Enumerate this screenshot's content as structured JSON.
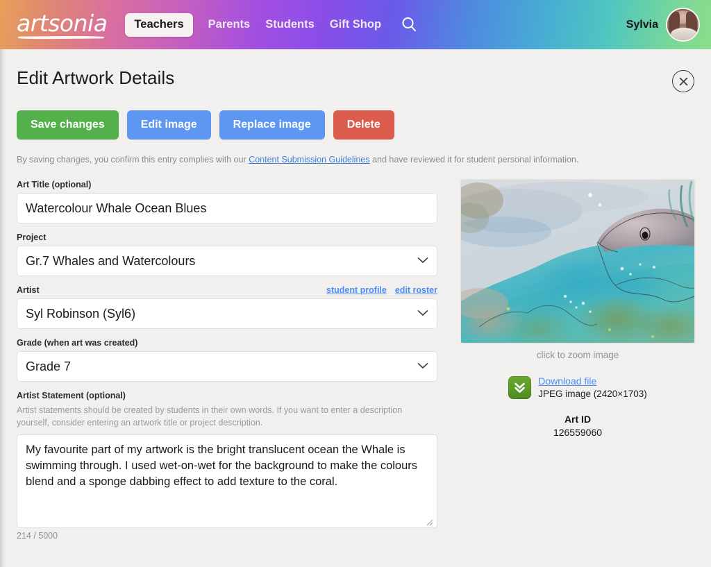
{
  "topnav": {
    "logo_text": "artsonia",
    "active_tab": "Teachers",
    "links": [
      "Parents",
      "Students",
      "Gift Shop"
    ],
    "search_icon": "search-icon",
    "user_name": "Sylvia",
    "gradient_start": "#e8a05a",
    "gradient_end": "#8ddc8a"
  },
  "page": {
    "title": "Edit Artwork Details",
    "close_icon": "close-icon"
  },
  "toolbar": {
    "save_label": "Save changes",
    "edit_image_label": "Edit image",
    "replace_image_label": "Replace image",
    "delete_label": "Delete",
    "save_color": "#53b04b",
    "edit_color": "#5d97f2",
    "replace_color": "#5d97f2",
    "delete_color": "#dc5c4e"
  },
  "disclaimer": {
    "before": "By saving changes, you confirm this entry complies with our ",
    "link": "Content Submission Guidelines",
    "after": " and have reviewed it for student personal information."
  },
  "form": {
    "art_title": {
      "label": "Art Title (optional)",
      "value": "Watercolour Whale Ocean Blues",
      "placeholder": ""
    },
    "project": {
      "label": "Project",
      "value": "Gr.7 Whales and Watercolours"
    },
    "artist": {
      "label": "Artist",
      "value": "Syl Robinson (Syl6)",
      "link_profile": "student profile",
      "link_roster": "edit roster"
    },
    "grade": {
      "label": "Grade (when art was created)",
      "value": "Grade 7"
    },
    "statement": {
      "label": "Artist Statement (optional)",
      "helper": "Artist statements should be created by students in their own words. If you want to enter a description yourself, consider entering an artwork title or project description.",
      "value": "My favourite part of my artwork is the bright translucent ocean the Whale is swimming through. I used wet-on-wet for the background to make the colours blend and a sponge dabbing effect to add texture to the coral.",
      "char_count": "214 / 5000"
    }
  },
  "preview": {
    "zoom_hint": "click to zoom image",
    "download_link": "Download file",
    "file_meta": "JPEG image (2420×1703)",
    "download_icon": "download-icon",
    "artid_label": "Art ID",
    "artid_value": "126559060"
  }
}
